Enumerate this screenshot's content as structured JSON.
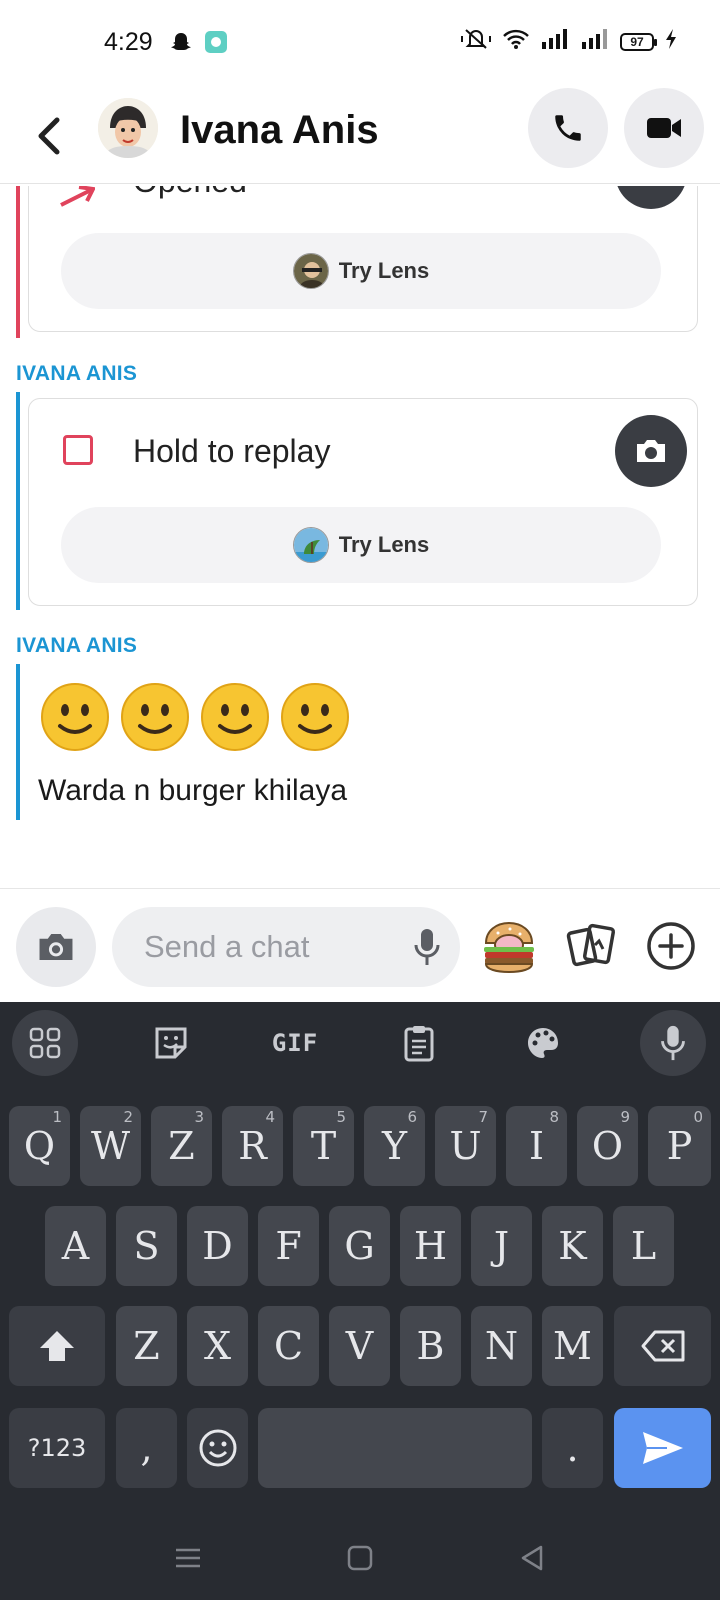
{
  "status_bar": {
    "time": "4:29",
    "battery": "97"
  },
  "header": {
    "contact_name": "Ivana Anis"
  },
  "messages": {
    "first_card": {
      "status": "Opened",
      "lens_label": "Try Lens"
    },
    "second": {
      "sender": "IVANA ANIS",
      "status": "Hold to replay",
      "lens_label": "Try Lens"
    },
    "third": {
      "sender": "IVANA ANIS",
      "emojis": [
        "🙂",
        "🙂",
        "🙂",
        "🙂"
      ],
      "text": "Warda n burger khilaya"
    }
  },
  "composer": {
    "placeholder": "Send a chat"
  },
  "keyboard": {
    "toolbar": {
      "gif_label": "GIF"
    },
    "row1": [
      {
        "label": "Q",
        "hint": "1"
      },
      {
        "label": "W",
        "hint": "2"
      },
      {
        "label": "Z",
        "hint": "3"
      },
      {
        "label": "R",
        "hint": "4"
      },
      {
        "label": "T",
        "hint": "5"
      },
      {
        "label": "Y",
        "hint": "6"
      },
      {
        "label": "U",
        "hint": "7"
      },
      {
        "label": "I",
        "hint": "8"
      },
      {
        "label": "O",
        "hint": "9"
      },
      {
        "label": "P",
        "hint": "0"
      }
    ],
    "row2": [
      "A",
      "S",
      "D",
      "F",
      "G",
      "H",
      "J",
      "K",
      "L"
    ],
    "row3": [
      "Z",
      "X",
      "C",
      "V",
      "B",
      "N",
      "M"
    ],
    "symbols_label": "?123",
    "comma": ",",
    "period": "."
  },
  "colors": {
    "sender_blue": "#1b95d3",
    "sent_red": "#e0435c",
    "keyboard_bg": "#282b31",
    "send_key": "#5b93f0"
  }
}
